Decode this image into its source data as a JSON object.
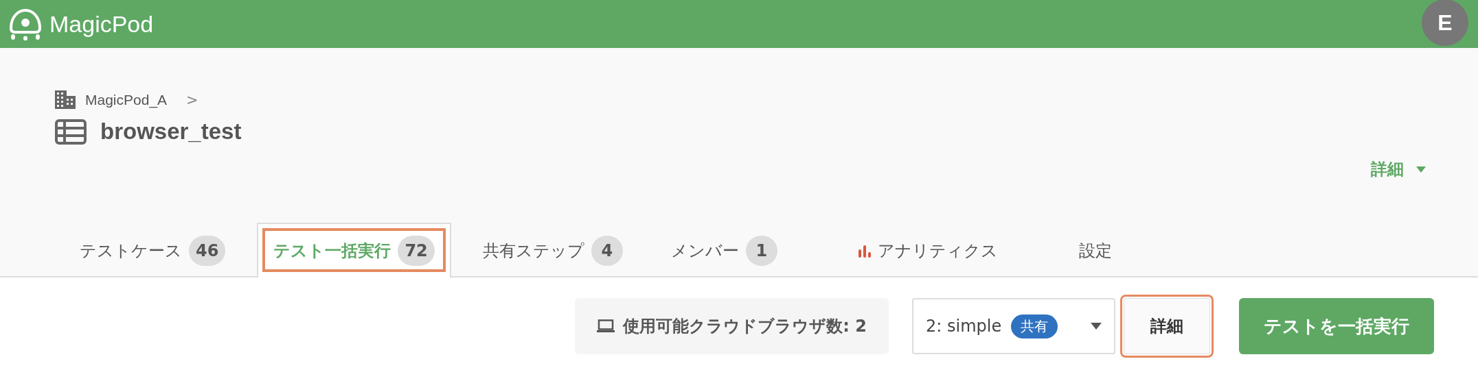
{
  "app": {
    "logo": "MagicPod",
    "avatar": "E"
  },
  "header": {
    "breadcrumb": "MagicPod_A",
    "separator": ">",
    "title": "browser_test",
    "menu": "詳細"
  },
  "tabs": [
    {
      "kind": "plain",
      "label": "テストケース",
      "count": "46",
      "selected": false,
      "highlighted": false
    },
    {
      "kind": "plain",
      "label": "テスト一括実行",
      "count": "72",
      "selected": true,
      "highlighted": true
    },
    {
      "kind": "plain",
      "label": "共有ステップ",
      "count": "4",
      "selected": false,
      "highlighted": false
    },
    {
      "kind": "plain",
      "label": "メンバー",
      "count": "1",
      "selected": false,
      "highlighted": false
    },
    {
      "kind": "chart",
      "label": "アナリティクス",
      "selected": false,
      "highlighted": false
    },
    {
      "kind": "plain",
      "label": "設定",
      "selected": false,
      "highlighted": false
    }
  ],
  "toolbar": {
    "browsers": "使用可能クラウドブラウザ数: 2",
    "setting": {
      "value": "2: simple",
      "badge": "共有"
    },
    "details_button": {
      "label": "詳細",
      "highlighted": true
    },
    "run_button": "テストを一括実行"
  }
}
